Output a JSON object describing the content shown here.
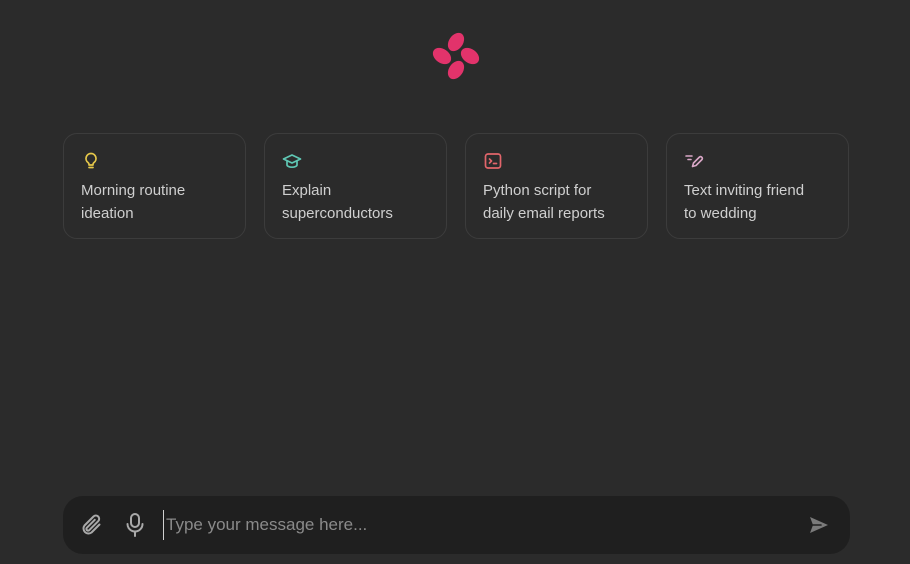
{
  "logo": {
    "icon": "petal-logo-icon",
    "color": "#e2336b"
  },
  "suggestions": [
    {
      "icon": "lightbulb-icon",
      "color": "#e6c84a",
      "label": "Morning routine\nideation"
    },
    {
      "icon": "graduation-cap-icon",
      "color": "#5fc7b4",
      "label": "Explain\nsuperconductors"
    },
    {
      "icon": "terminal-icon",
      "color": "#e2656b",
      "label": "Python script for\ndaily email reports"
    },
    {
      "icon": "pen-icon",
      "color": "#d9a7c7",
      "label": "Text inviting friend\nto wedding"
    }
  ],
  "composer": {
    "placeholder": "Type your message here...",
    "value": "",
    "attach_icon": "paperclip-icon",
    "mic_icon": "microphone-icon",
    "send_icon": "send-icon"
  }
}
